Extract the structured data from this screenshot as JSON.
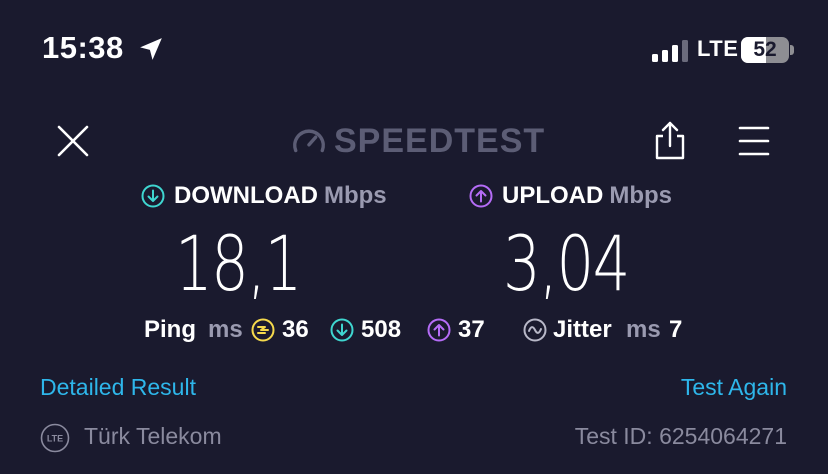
{
  "status_bar": {
    "time": "15:38",
    "network": "LTE",
    "battery_percent": 52,
    "battery_text": "52",
    "location_icon": "location-arrow-icon",
    "signal_icon": "cellular-signal-icon"
  },
  "header": {
    "logo_text": "SPEEDTEST",
    "close_icon": "close-icon",
    "share_icon": "share-icon",
    "menu_icon": "hamburger-menu-icon"
  },
  "results": {
    "download": {
      "label": "DOWNLOAD",
      "unit": "Mbps",
      "value": "18,1",
      "color": "#3fd6d0"
    },
    "upload": {
      "label": "UPLOAD",
      "unit": "Mbps",
      "value": "3,04",
      "color": "#b56cf7"
    }
  },
  "latency": {
    "ping_label": "Ping",
    "ping_unit": "ms",
    "idle": "36",
    "idle_color": "#f5d94c",
    "download": "508",
    "upload": "37",
    "jitter_label": "Jitter",
    "jitter_unit": "ms",
    "jitter": "7"
  },
  "links": {
    "detailed": "Detailed Result",
    "again": "Test Again",
    "color": "#2eb6ea"
  },
  "footer": {
    "isp_badge": "LTE",
    "isp": "Türk Telekom",
    "test_id": "Test ID: 6254064271"
  }
}
